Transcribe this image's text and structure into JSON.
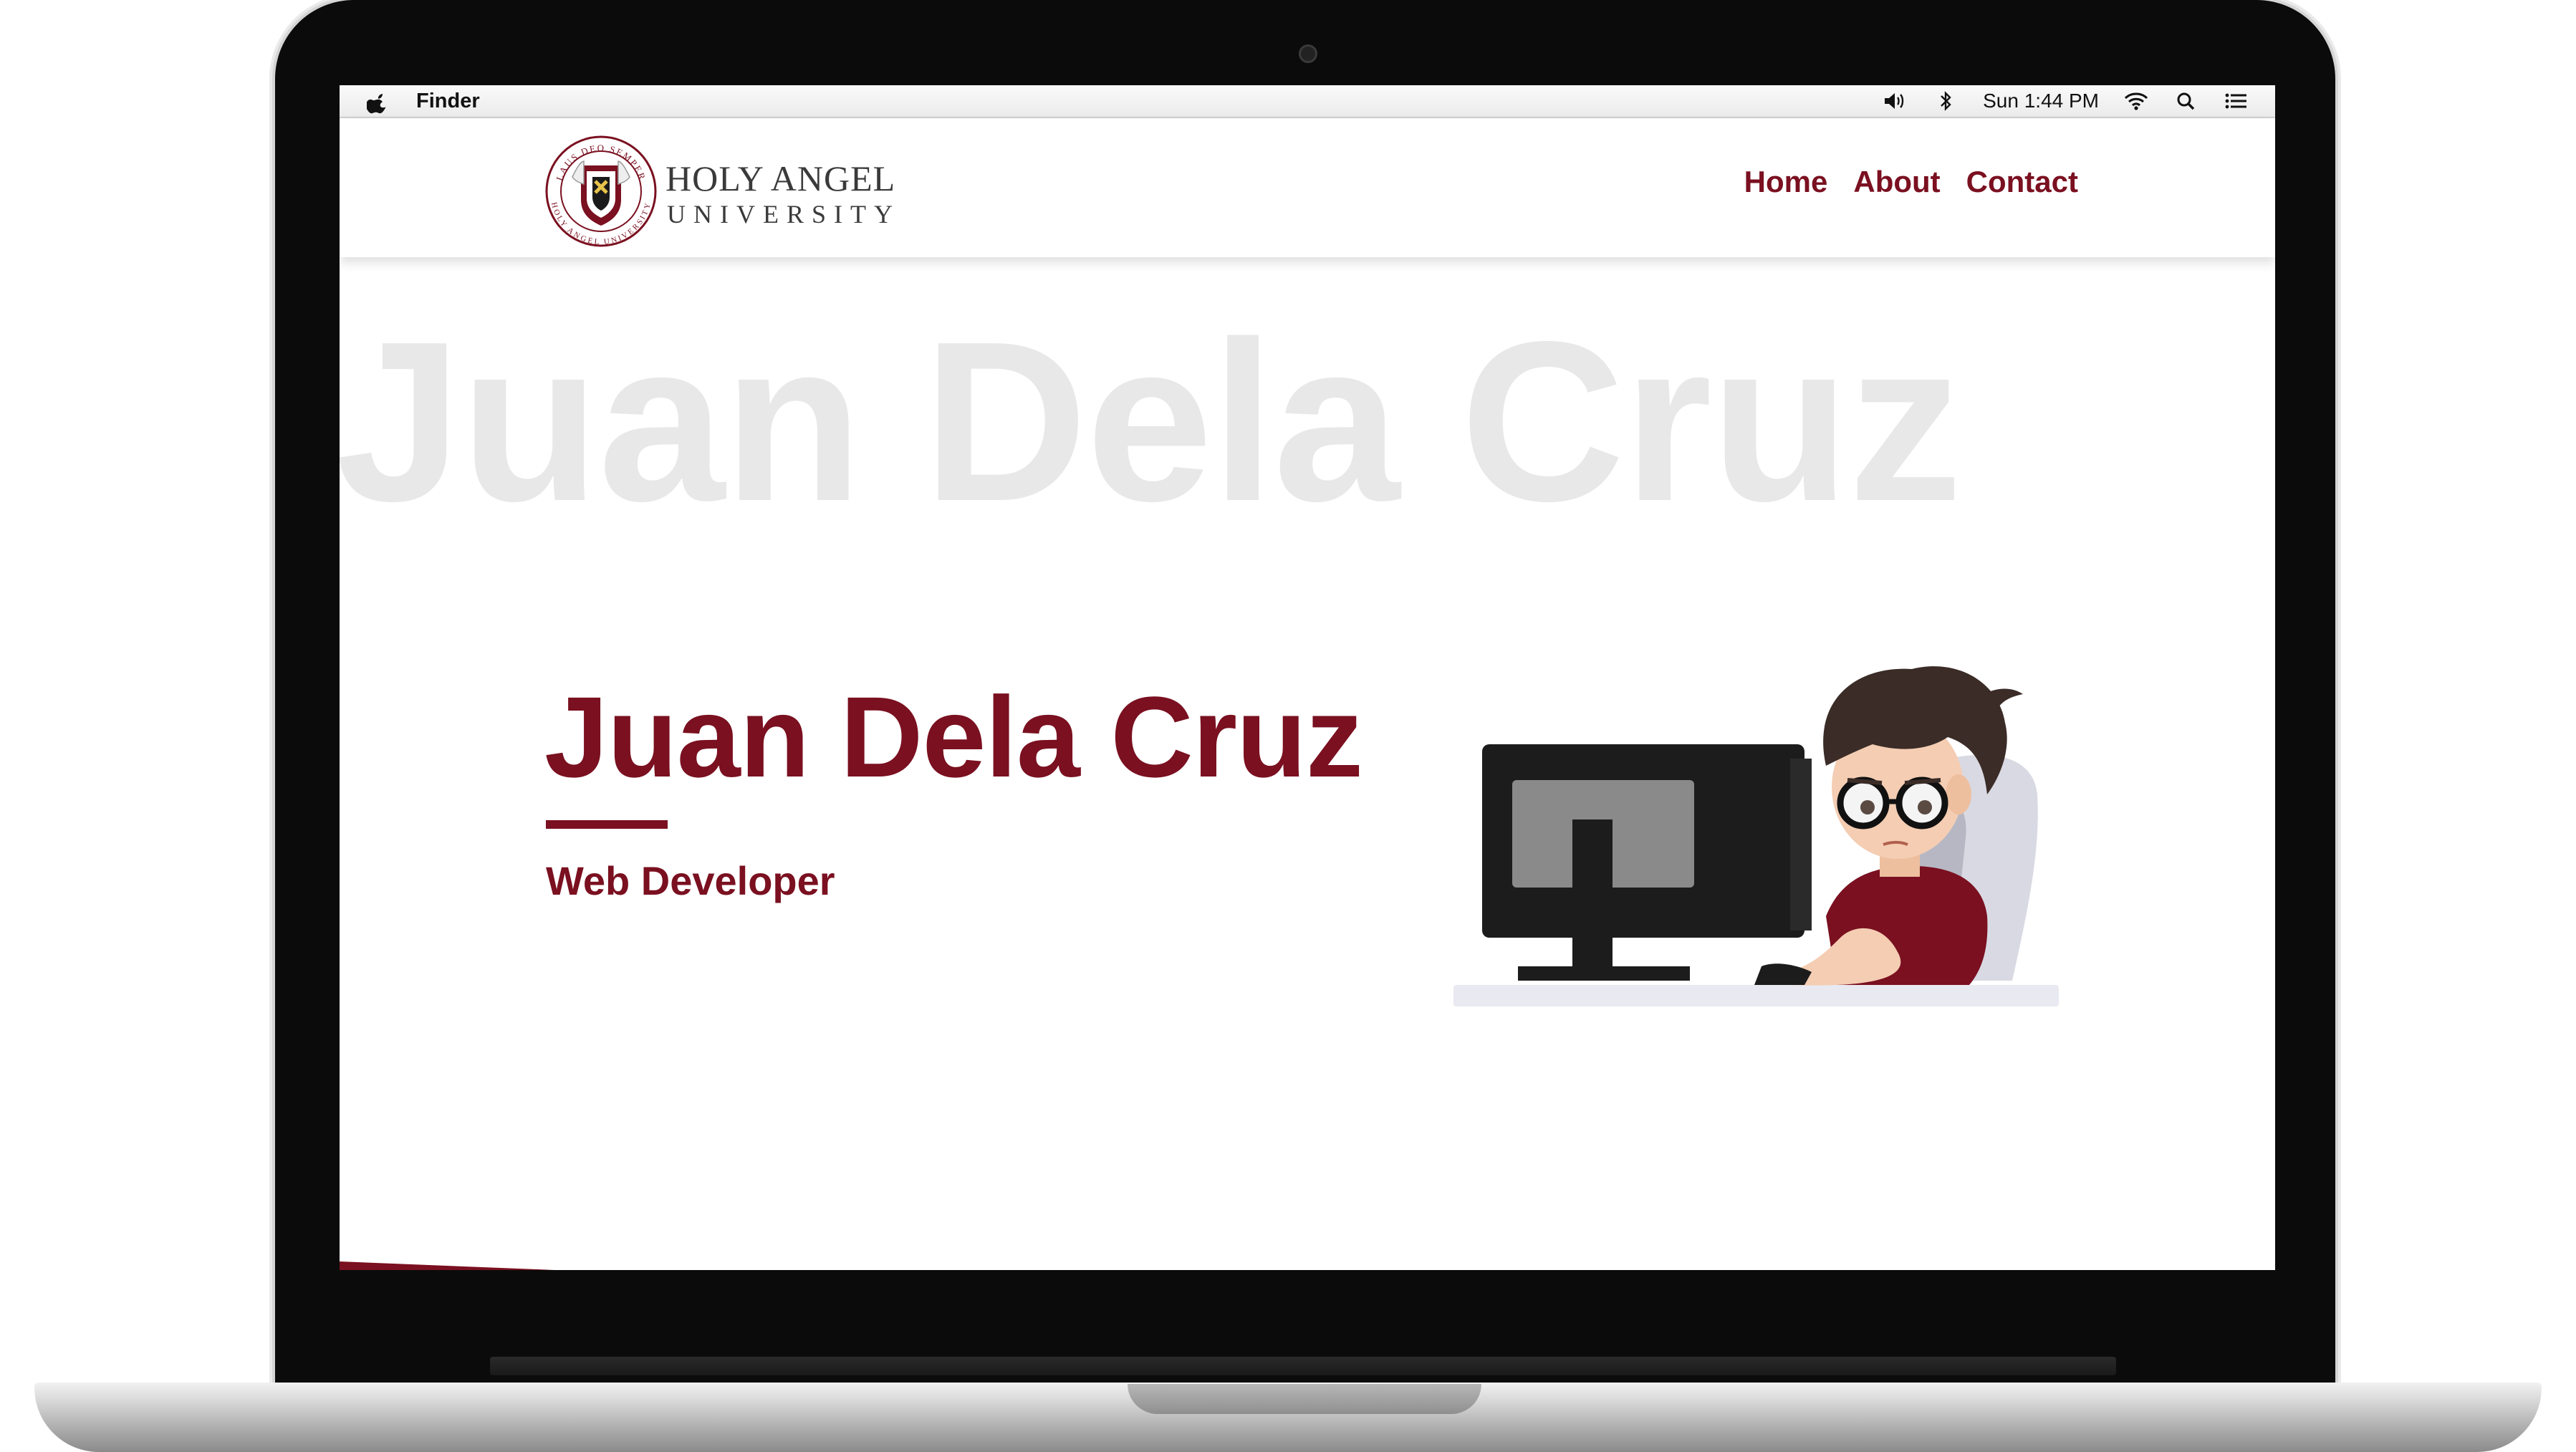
{
  "menubar": {
    "app_name": "Finder",
    "clock": "Sun 1:44 PM",
    "icons": [
      "apple-icon",
      "volume-icon",
      "bluetooth-icon",
      "wifi-icon",
      "spotlight-search-icon",
      "notification-center-icon"
    ]
  },
  "site": {
    "logo": {
      "line1": "HOLY ANGEL",
      "line2": "UNIVERSITY",
      "seal_text_top": "LAUS DEO SEMPER",
      "seal_text_bottom": "HOLY ANGEL UNIVERSITY"
    },
    "nav": [
      {
        "label": "Home"
      },
      {
        "label": "About"
      },
      {
        "label": "Contact"
      }
    ]
  },
  "hero": {
    "background_name": "Juan Dela Cruz",
    "name": "Juan Dela Cruz",
    "role": "Web Developer",
    "illustration": "developer-at-computer-illustration"
  },
  "colors": {
    "brand_maroon": "#7a1020",
    "watermark_gray": "#e8e8e8"
  }
}
